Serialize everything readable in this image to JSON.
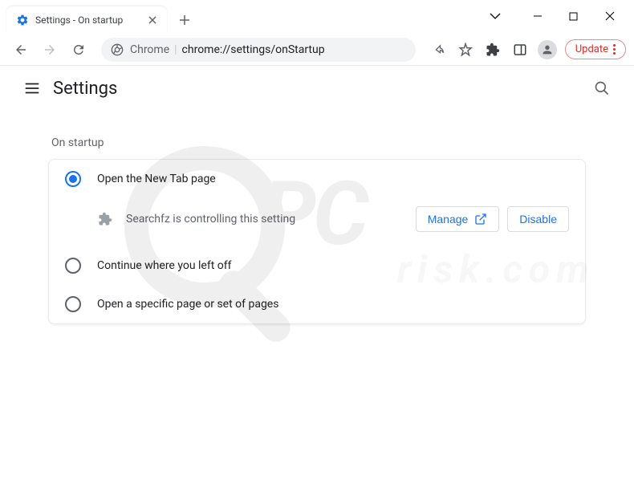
{
  "window": {
    "tab_title": "Settings - On startup"
  },
  "omnibox": {
    "prefix": "Chrome",
    "url": "chrome://settings/onStartup"
  },
  "toolbar": {
    "update_label": "Update"
  },
  "header": {
    "title": "Settings"
  },
  "section": {
    "title": "On startup"
  },
  "options": {
    "new_tab": "Open the New Tab page",
    "continue": "Continue where you left off",
    "specific": "Open a specific page or set of pages"
  },
  "notice": {
    "text": "Searchfz is controlling this setting",
    "manage": "Manage",
    "disable": "Disable"
  },
  "watermark": {
    "main": "PC",
    "sub": "risk.com"
  }
}
